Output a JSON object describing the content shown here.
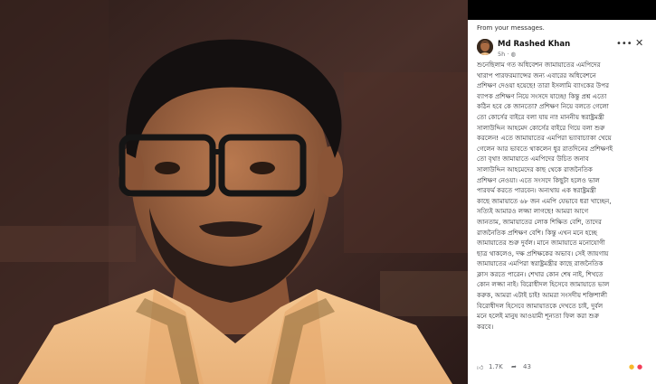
{
  "post": {
    "from_label": "From your messages.",
    "author": "Md Rashed Khan",
    "time": "5h",
    "time_suffix": "·",
    "more_icon": "more-dots-icon",
    "close_icon": "close-icon",
    "lines": [
      "শুনেছিলাম গত অধিবেশন জামায়াতের এমপিদের",
      "খারাপ পারফরম্যান্সের জন্য এবারের অধিবেশনে",
      "প্রশিক্ষণ দেওয়া হয়েছে! তারা ইসলামি ব্যাংকের উপর",
      "ব্যাপক প্রশিক্ষণ নিয়ে সংসদে যাচ্ছে! কিন্তু প্রশ্ন এতো",
      "কঠিন হবে কে জানতো? প্রশিক্ষণ নিয়ে বলতে গেলো",
      "তো কোর্সের বাইরে বলা যায় না! মাননীয় স্বরাষ্ট্রমন্ত্রী",
      "সালাউদ্দিন আহমেদ কোর্সের বাইরে গিয়ে বলা শুরু",
      "করলেন! এতে জামায়াতের এমপিরা ভ্যাবাচ্যাকা খেয়ে",
      "গেলেন আর ভাবতে থাকলেন ধুর রাতদিনের প্রশিক্ষণই",
      "তো বৃথা! জামায়াতে এমপিদের উচিত জনাব",
      "সালাউদ্দিন আহমেদের কাছ থেকে রাজনৈতিক",
      "প্রশিক্ষণ নেওয়া। এতে সংসদে কিছুটা হলেও ভাল",
      "পারফর্ম করতে পারবেন। অন্যথায় এক স্বরাষ্ট্রমন্ত্রী",
      "কাছে জামায়াতে ৬৮ জন এমপি যেভাবে ধরা খাচ্ছেন,",
      "সত্যিই আমারও লজ্জা লাগছে! আমরা আগে",
      "জানতাম, জামায়াতের লোক শিক্ষিত বেশি, তাদের",
      "রাজনৈতিক প্রশিক্ষণ বেশি। কিন্তু এখন মনে হচ্ছে",
      "জামায়াতের শুরু দুর্বল। মানে জামায়াতে মনোযোগী",
      "ছাত্র থাকলেও, দক্ষ প্রশিক্ষকের অভাব। সেই জায়গায়",
      "জামায়াতের এমপিরা স্বরাষ্ট্রমন্ত্রীর কাছে রাজনৈতিক",
      "ক্লাস করতে পারেন। শেখার কোন শেষ নাই, শিখতে",
      "কোন লজ্জা নাই। বিরোধীদল হিসেবে জামায়াতে ভাল",
      "করুক, আমরা এটাই চাই! আমরা সংসদীয় শক্তিশালী",
      "বিরোধীদল হিসেবে জামায়াতকে দেখতে চাই, দুর্বল",
      "মনে হলেই মানুষ আওয়ামী শূন্যতা ফিল করা শুরু",
      "করবে।"
    ],
    "likes": "1.7K",
    "shares": "43",
    "like_icon": "thumbs-up-icon",
    "share_icon": "share-arrow-icon",
    "reaction_icons": [
      "haha-reaction-icon",
      "love-reaction-icon"
    ]
  },
  "colors": {
    "shirt": "#f2c28a",
    "background_dark": "#3a2622",
    "facebook_blue": "#1877f2"
  }
}
